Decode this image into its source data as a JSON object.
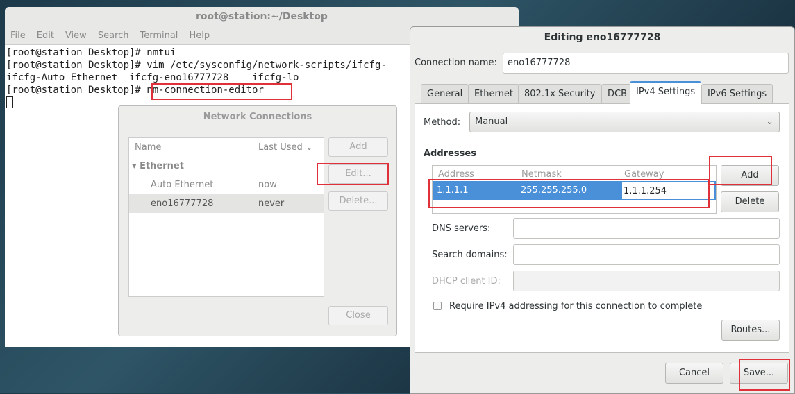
{
  "terminal": {
    "title": "root@station:~/Desktop",
    "menu": [
      "File",
      "Edit",
      "View",
      "Search",
      "Terminal",
      "Help"
    ],
    "lines": [
      "[root@station Desktop]# nmtui",
      "[root@station Desktop]# vim /etc/sysconfig/network-scripts/ifcfg-",
      "ifcfg-Auto_Ethernet  ifcfg-eno16777728    ifcfg-lo",
      "[root@station Desktop]# "
    ],
    "command": "nm-connection-editor"
  },
  "network_connections": {
    "title": "Network Connections",
    "col_name": "Name",
    "col_last_used": "Last Used",
    "group": "Ethernet",
    "rows": [
      {
        "name": "Auto Ethernet",
        "last_used": "now"
      },
      {
        "name": "eno16777728",
        "last_used": "never"
      }
    ],
    "add": "Add",
    "edit": "Edit...",
    "delete": "Delete...",
    "close": "Close"
  },
  "editor": {
    "title": "Editing eno16777728",
    "conn_label": "Connection name:",
    "conn_value": "eno16777728",
    "tabs": [
      "General",
      "Ethernet",
      "802.1x Security",
      "DCB",
      "IPv4 Settings",
      "IPv6 Settings"
    ],
    "active_tab": "IPv4 Settings",
    "method_label": "Method:",
    "method_value": "Manual",
    "addresses_title": "Addresses",
    "cols": [
      "Address",
      "Netmask",
      "Gateway"
    ],
    "address": "1.1.1.1",
    "netmask": "255.255.255.0",
    "gateway": "1.1.1.254",
    "add": "Add",
    "delete": "Delete",
    "dns_label": "DNS servers:",
    "search_label": "Search domains:",
    "dhcp_label": "DHCP client ID:",
    "require_label": "Require IPv4 addressing for this connection to complete",
    "routes": "Routes...",
    "cancel": "Cancel",
    "save": "Save..."
  }
}
